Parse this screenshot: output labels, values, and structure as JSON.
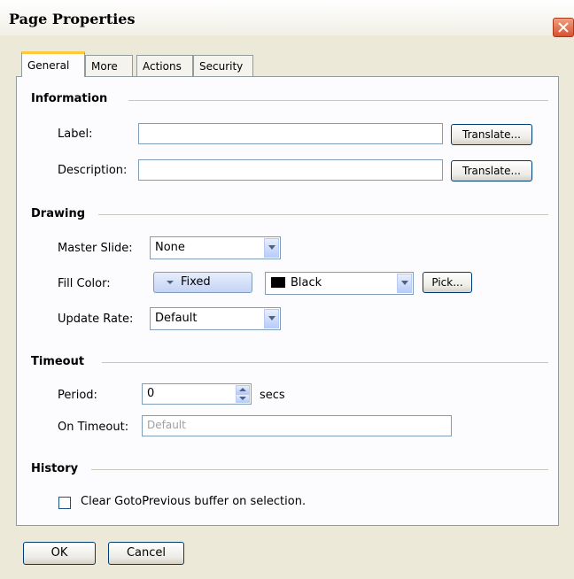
{
  "window": {
    "title": "Page Properties"
  },
  "tabs": [
    {
      "label": "General"
    },
    {
      "label": "More"
    },
    {
      "label": "Actions"
    },
    {
      "label": "Security"
    }
  ],
  "information": {
    "heading": "Information",
    "label_field": {
      "label": "Label:",
      "value": "",
      "button": "Translate..."
    },
    "description_field": {
      "label": "Description:",
      "value": "",
      "button": "Translate..."
    }
  },
  "drawing": {
    "heading": "Drawing",
    "master_slide": {
      "label": "Master Slide:",
      "value": "None"
    },
    "fill_color": {
      "label": "Fill Color:",
      "mode": "Fixed",
      "color_name": "Black",
      "color_hex": "#000000",
      "pick_button": "Pick..."
    },
    "update_rate": {
      "label": "Update Rate:",
      "value": "Default"
    }
  },
  "timeout": {
    "heading": "Timeout",
    "period": {
      "label": "Period:",
      "value": "0",
      "unit": "secs"
    },
    "on_timeout": {
      "label": "On Timeout:",
      "placeholder": "Default"
    }
  },
  "history": {
    "heading": "History",
    "clear_buffer": {
      "label": "Clear GotoPrevious buffer on selection.",
      "checked": false
    }
  },
  "footer": {
    "ok": "OK",
    "cancel": "Cancel"
  }
}
